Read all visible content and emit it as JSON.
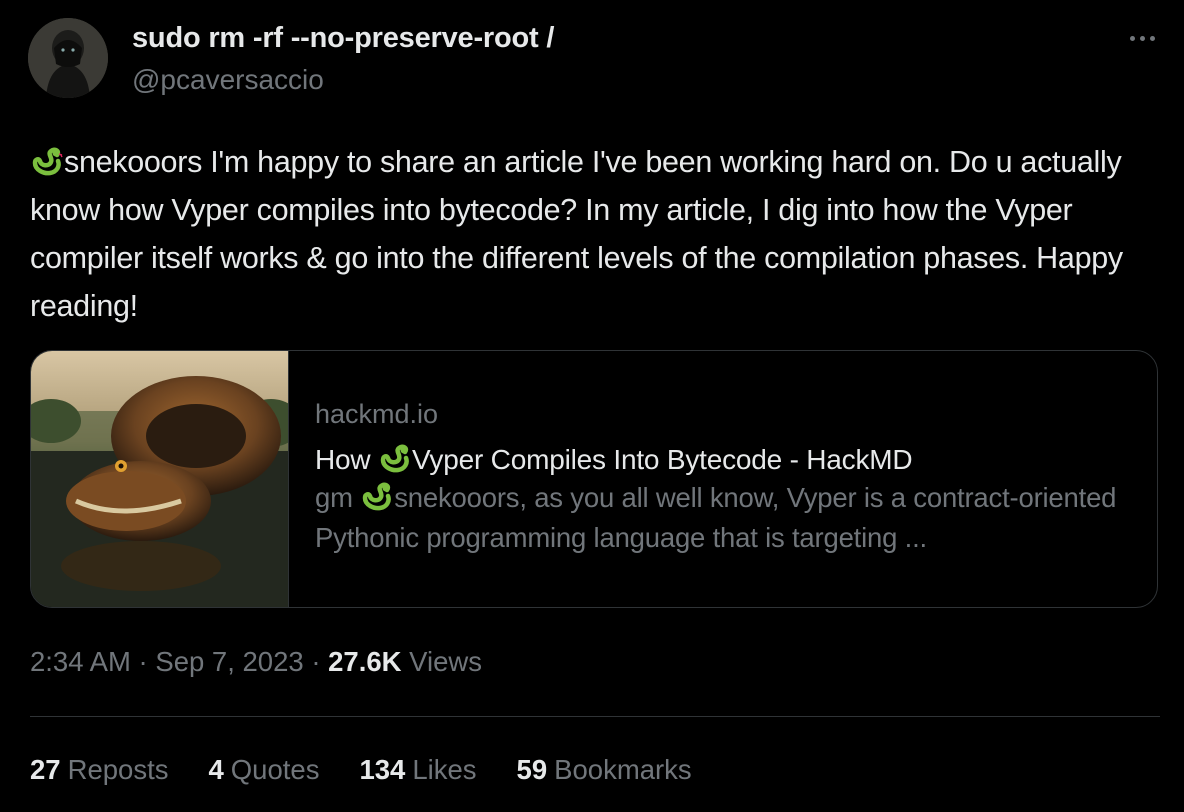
{
  "author": {
    "display_name": "sudo rm -rf --no-preserve-root /",
    "handle": "@pcaversaccio"
  },
  "tweet": {
    "text": "snekooors I'm happy to share an article I've been working hard on. Do u actually know how Vyper compiles into bytecode? In my article, I dig into how the Vyper compiler itself works & go into the different levels of the compilation phases. Happy reading!",
    "leading_emoji": "snake-icon"
  },
  "card": {
    "domain": "hackmd.io",
    "title_pre": "How ",
    "title_post": "Vyper Compiles Into Bytecode - HackMD",
    "desc_pre": "gm ",
    "desc_post": "snekooors, as you all well know, Vyper is a contract-oriented Pythonic programming language that is targeting ..."
  },
  "meta": {
    "time": "2:34 AM",
    "date": "Sep 7, 2023",
    "views_count": "27.6K",
    "views_label": "Views",
    "sep": "·"
  },
  "stats": [
    {
      "count": "27",
      "label": "Reposts"
    },
    {
      "count": "4",
      "label": "Quotes"
    },
    {
      "count": "134",
      "label": "Likes"
    },
    {
      "count": "59",
      "label": "Bookmarks"
    }
  ],
  "colors": {
    "background": "#000000",
    "text": "#e7e9ea",
    "secondary": "#71767b",
    "border": "#2f3336",
    "snake_green": "#7bbf3e"
  }
}
